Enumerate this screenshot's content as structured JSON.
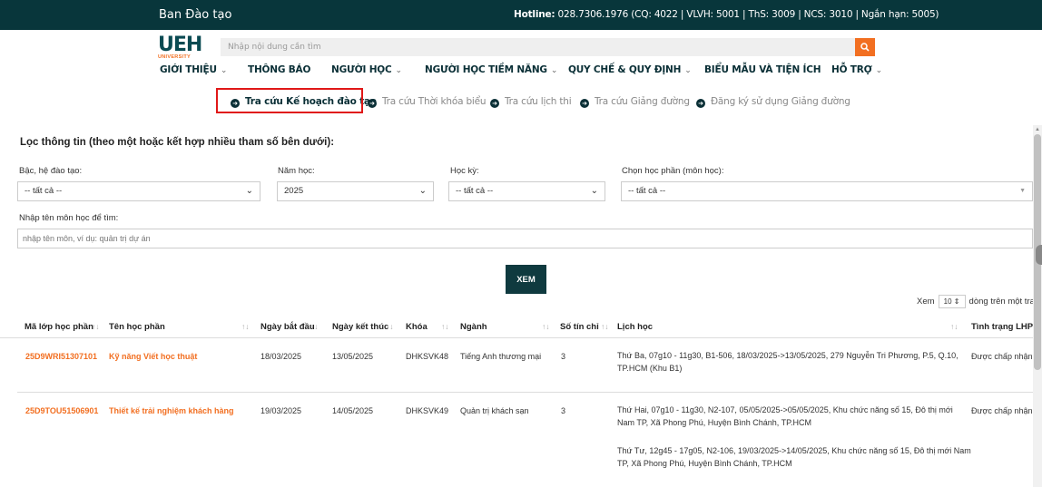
{
  "topbar": {
    "brand": "Ban Đào tạo",
    "hotline_label": "Hotline:",
    "hotline_text": " 028.7306.1976 (CQ: 4022 | VLVH: 5001 | ThS: 3009 | NCS: 3010 | Ngắn hạn: 5005)"
  },
  "logo": {
    "main": "UEH",
    "sub": "UNIVERSITY"
  },
  "search": {
    "placeholder": "Nhập nội dung cần tìm"
  },
  "nav": [
    {
      "label": "GIỚI THIỆU",
      "dropdown": true
    },
    {
      "label": "THÔNG BÁO",
      "dropdown": false
    },
    {
      "label": "NGƯỜI HỌC",
      "dropdown": true
    },
    {
      "label": "NGƯỜI HỌC TIỀM NĂNG",
      "dropdown": true
    },
    {
      "label": "QUY CHẾ & QUY ĐỊNH",
      "dropdown": true
    },
    {
      "label": "BIỂU MẪU VÀ TIỆN ÍCH",
      "dropdown": false
    },
    {
      "label": "HỖ TRỢ",
      "dropdown": true
    }
  ],
  "subnav": [
    "Tra cứu Kế hoạch đào tạo",
    "Tra cứu Thời khóa biểu",
    "Tra cứu lịch thi",
    "Tra cứu Giảng đường",
    "Đăng ký sử dụng Giảng đường"
  ],
  "filter": {
    "title": "Lọc thông tin (theo một hoặc kết hợp nhiều tham số bên dưới):",
    "level_label": "Bậc, hệ đào tạo:",
    "level_value": "-- tất cả --",
    "year_label": "Năm học:",
    "year_value": "2025",
    "term_label": "Học kỳ:",
    "term_value": "-- tất cả --",
    "course_label": "Chọn học phần (môn học):",
    "course_value": "-- tất cả --",
    "subject_label": "Nhập tên môn học để tìm:",
    "subject_placeholder": "nhập tên môn, ví dụ: quản trị dự án",
    "submit": "XEM"
  },
  "pager": {
    "prefix": "Xem",
    "value": "10",
    "suffix": "dòng trên một trang"
  },
  "table": {
    "headers": [
      "Mã lớp học phần",
      "Tên học phần",
      "Ngày bắt đầu",
      "Ngày kết thúc",
      "Khóa",
      "Ngành",
      "Số tín chỉ",
      "Lịch học",
      "Tình trạng LHP"
    ],
    "rows": [
      {
        "code": "25D9WRI51307101",
        "name": "Kỹ năng Viết học thuật",
        "start": "18/03/2025",
        "end": "13/05/2025",
        "cohort": "DHKSVK48",
        "major": "Tiếng Anh thương mại",
        "credits": "3",
        "schedule": [
          "Thứ Ba, 07g10 - 11g30, B1-506, 18/03/2025->13/05/2025, 279 Nguyễn Tri Phương, P.5, Q.10, TP.HCM (Khu B1)"
        ],
        "status": "Được chấp nhận"
      },
      {
        "code": "25D9TOU51506901",
        "name": "Thiết kế trải nghiệm khách hàng",
        "start": "19/03/2025",
        "end": "14/05/2025",
        "cohort": "DHKSVK49",
        "major": "Quản trị khách sạn",
        "credits": "3",
        "schedule": [
          "Thứ Hai, 07g10 - 11g30, N2-107, 05/05/2025->05/05/2025, Khu chức năng số 15, Đô thị mới Nam TP, Xã Phong Phú, Huyện Bình Chánh, TP.HCM",
          "Thứ Tư, 12g45 - 17g05, N2-106, 19/03/2025->14/05/2025, Khu chức năng số 15, Đô thị mới Nam TP, Xã Phong Phú, Huyện Bình Chánh, TP.HCM"
        ],
        "status": "Được chấp nhận"
      }
    ]
  },
  "colors": {
    "primary": "#08363b",
    "accent": "#f26f21",
    "highlight": "#e01818"
  }
}
